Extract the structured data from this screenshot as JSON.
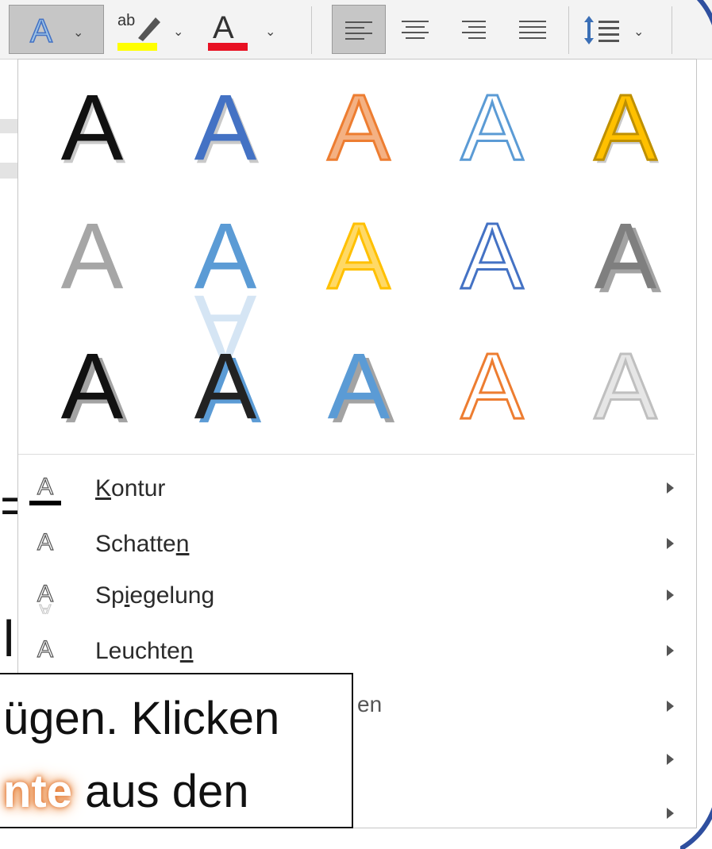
{
  "toolbar": {
    "text_effects_button": "A",
    "highlight_button": "ab",
    "font_color_button": "A",
    "highlight_color": "#ffff00",
    "font_color": "#e81123",
    "caret": "⌄"
  },
  "gallery": {
    "rows": [
      [
        {
          "name": "fill-black-shadow",
          "fill": "#111111",
          "stroke": "none",
          "style": "shadow"
        },
        {
          "name": "fill-blue-shadow",
          "fill": "#4472c4",
          "stroke": "none",
          "style": "shadow"
        },
        {
          "name": "fill-orange-outline",
          "fill": "#f4b183",
          "stroke": "#ed7d31",
          "style": "plain"
        },
        {
          "name": "outline-blue",
          "fill": "#ffffff",
          "stroke": "#5b9bd5",
          "style": "plain"
        },
        {
          "name": "fill-gold-bevel",
          "fill": "#ffc000",
          "stroke": "#bf9000",
          "style": "shadow"
        }
      ],
      [
        {
          "name": "fill-gray",
          "fill": "#a6a6a6",
          "stroke": "none",
          "style": "plain"
        },
        {
          "name": "fill-blue-reflection",
          "fill": "#5b9bd5",
          "stroke": "none",
          "style": "reflection"
        },
        {
          "name": "fill-gold-outline",
          "fill": "#ffd966",
          "stroke": "#ffc000",
          "style": "plain"
        },
        {
          "name": "outline-blue-double",
          "fill": "#ffffff",
          "stroke": "#4472c4",
          "style": "plain"
        },
        {
          "name": "fill-gray-3d",
          "fill": "#7f7f7f",
          "stroke": "none",
          "style": "3d"
        }
      ],
      [
        {
          "name": "fill-black-3d",
          "fill": "#111111",
          "stroke": "none",
          "style": "3d"
        },
        {
          "name": "fill-dark-blue-shadow",
          "fill": "#222222",
          "stroke": "none",
          "style": "blueshadow"
        },
        {
          "name": "fill-blue-3d",
          "fill": "#5b9bd5",
          "stroke": "none",
          "style": "3d"
        },
        {
          "name": "outline-orange-3d",
          "fill": "#ffffff",
          "stroke": "#ed7d31",
          "style": "plain"
        },
        {
          "name": "fill-white-gray",
          "fill": "#e6e6e6",
          "stroke": "#bfbfbf",
          "style": "plain"
        }
      ]
    ]
  },
  "menu": {
    "items": [
      {
        "pre": "",
        "key": "K",
        "post": "ontur",
        "icon": "outline-icon"
      },
      {
        "pre": "Schatte",
        "key": "n",
        "post": "",
        "icon": "shadow-icon"
      },
      {
        "pre": "Sp",
        "key": "i",
        "post": "egelung",
        "icon": "reflection-icon"
      },
      {
        "pre": "Leuchte",
        "key": "n",
        "post": "",
        "icon": "glow-icon"
      },
      {
        "pre": "",
        "key": "",
        "post": "",
        "icon": ""
      },
      {
        "pre": "",
        "key": "",
        "post": "",
        "icon": ""
      },
      {
        "pre": "",
        "key": "",
        "post": "",
        "icon": ""
      }
    ],
    "partial_label_fragment": "en"
  },
  "document": {
    "line1": "ügen. Klicken",
    "line2_glow": "nte",
    "line2_rest": " aus den",
    "left_glyph_1": "=",
    "left_glyph_2": "l"
  }
}
